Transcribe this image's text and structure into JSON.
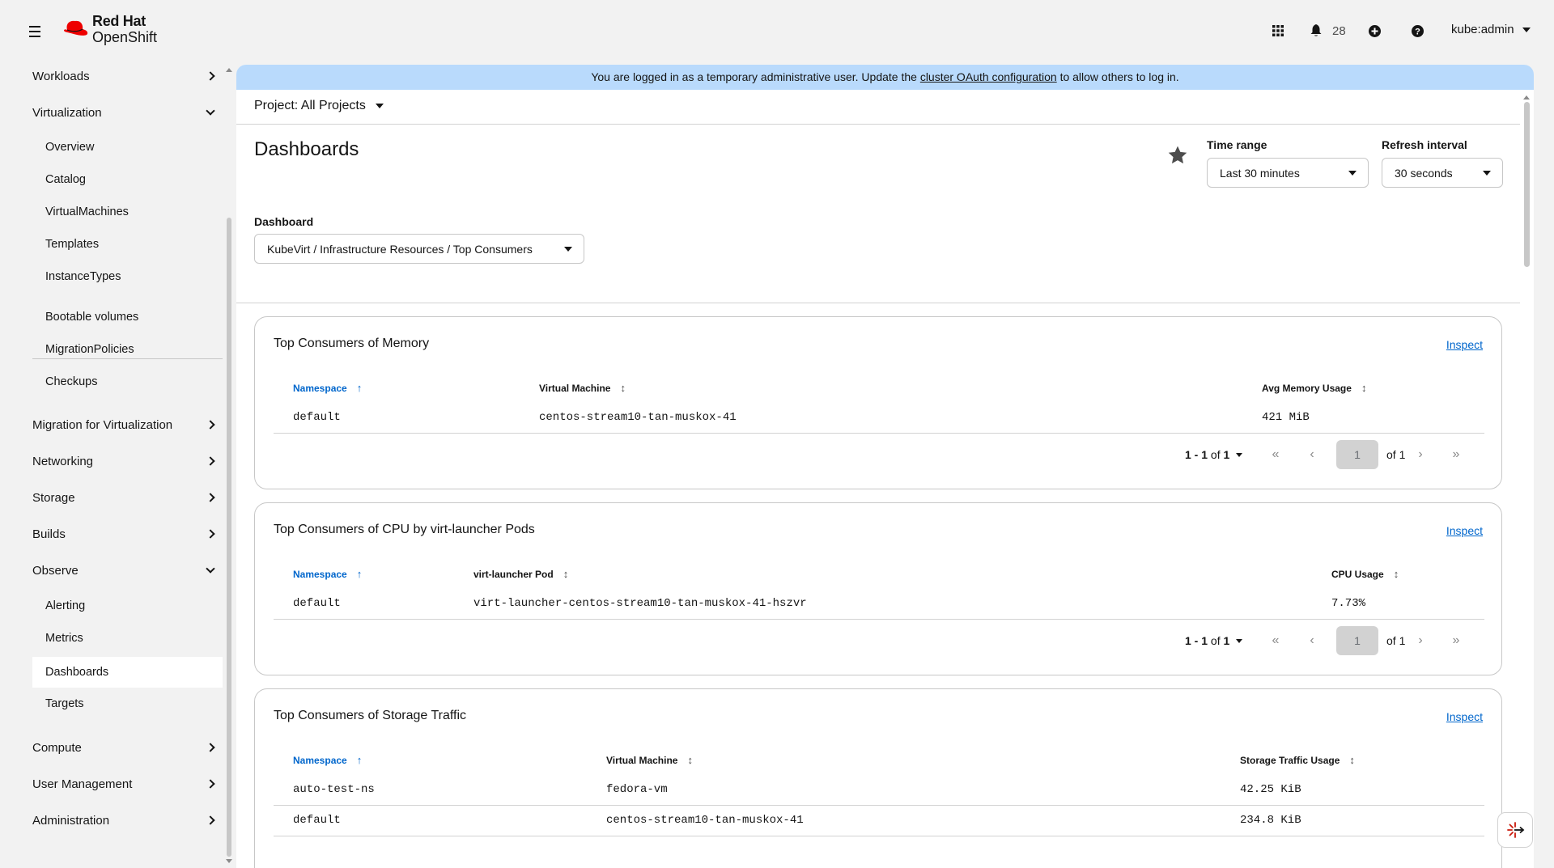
{
  "app": {
    "brand_line1": "Red Hat",
    "brand_line2": "OpenShift"
  },
  "masthead": {
    "notification_count": "28",
    "user": "kube:admin"
  },
  "sidebar": {
    "items": [
      {
        "label": "Workloads"
      },
      {
        "label": "Virtualization"
      },
      {
        "label": "Overview"
      },
      {
        "label": "Catalog"
      },
      {
        "label": "VirtualMachines"
      },
      {
        "label": "Templates"
      },
      {
        "label": "InstanceTypes"
      },
      {
        "label": "Bootable volumes"
      },
      {
        "label": "MigrationPolicies"
      },
      {
        "label": "Checkups"
      },
      {
        "label": "Migration for Virtualization"
      },
      {
        "label": "Networking"
      },
      {
        "label": "Storage"
      },
      {
        "label": "Builds"
      },
      {
        "label": "Observe"
      },
      {
        "label": "Alerting"
      },
      {
        "label": "Metrics"
      },
      {
        "label": "Dashboards"
      },
      {
        "label": "Targets"
      },
      {
        "label": "Compute"
      },
      {
        "label": "User Management"
      },
      {
        "label": "Administration"
      }
    ]
  },
  "banner": {
    "text_before": "You are logged in as a temporary administrative user. Update the ",
    "link": "cluster OAuth configuration",
    "text_after": " to allow others to log in."
  },
  "project": {
    "label": "Project: All Projects"
  },
  "page": {
    "title": "Dashboards",
    "time_range_label": "Time range",
    "time_range_value": "Last 30 minutes",
    "refresh_label": "Refresh interval",
    "refresh_value": "30 seconds",
    "dashboard_label": "Dashboard",
    "dashboard_value": "KubeVirt / Infrastructure Resources / Top Consumers"
  },
  "cards": [
    {
      "title": "Top Consumers of Memory",
      "inspect": "Inspect",
      "columns": [
        "Namespace",
        "Virtual Machine",
        "Avg Memory Usage"
      ],
      "rows": [
        [
          "default",
          "centos-stream10-tan-muskox-41",
          "421 MiB"
        ]
      ],
      "pager": {
        "range": "1 - 1",
        "of_label": "of",
        "total": "1",
        "page": "1",
        "of_pages": "of 1"
      }
    },
    {
      "title": "Top Consumers of CPU by virt-launcher Pods",
      "inspect": "Inspect",
      "columns": [
        "Namespace",
        "virt-launcher Pod",
        "CPU Usage"
      ],
      "rows": [
        [
          "default",
          "virt-launcher-centos-stream10-tan-muskox-41-hszvr",
          "7.73%"
        ]
      ],
      "pager": {
        "range": "1 - 1",
        "of_label": "of",
        "total": "1",
        "page": "1",
        "of_pages": "of 1"
      }
    },
    {
      "title": "Top Consumers of Storage Traffic",
      "inspect": "Inspect",
      "columns": [
        "Namespace",
        "Virtual Machine",
        "Storage Traffic Usage"
      ],
      "rows": [
        [
          "auto-test-ns",
          "fedora-vm",
          "42.25 KiB"
        ],
        [
          "default",
          "centos-stream10-tan-muskox-41",
          "234.8 KiB"
        ]
      ]
    }
  ]
}
